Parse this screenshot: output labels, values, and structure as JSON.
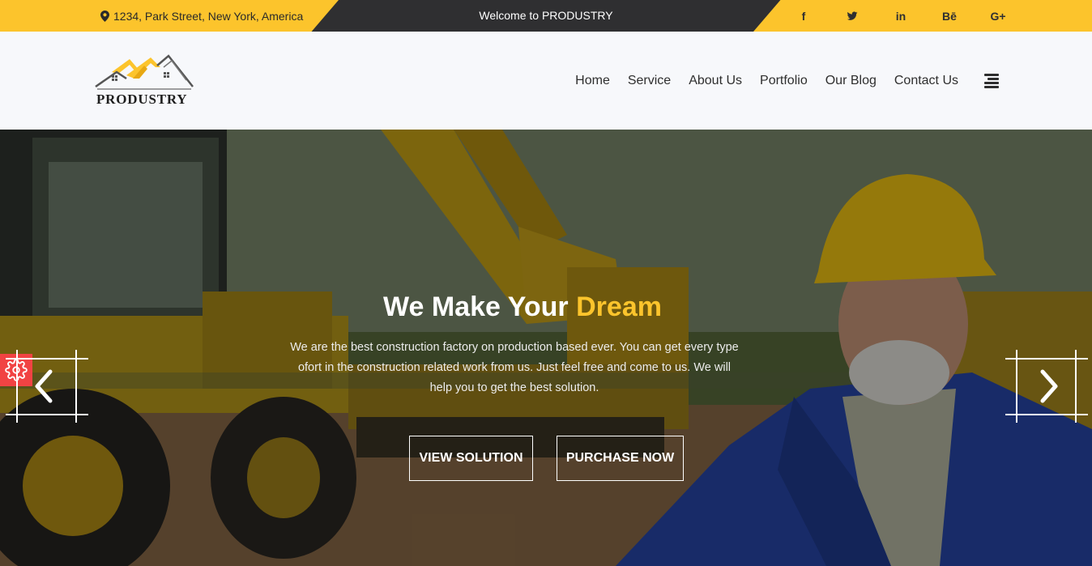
{
  "topbar": {
    "address": "1234, Park Street, New York, America",
    "welcome": "Welcome to PRODUSTRY",
    "social": [
      {
        "name": "facebook-icon",
        "label": "f"
      },
      {
        "name": "twitter-icon",
        "label": ""
      },
      {
        "name": "linkedin-icon",
        "label": "in"
      },
      {
        "name": "behance-icon",
        "label": "Bē"
      },
      {
        "name": "google-plus-icon",
        "label": "G+"
      }
    ]
  },
  "header": {
    "logo_text": "PRODUSTRY",
    "nav": [
      "Home",
      "Service",
      "About Us",
      "Portfolio",
      "Our Blog",
      "Contact Us"
    ]
  },
  "hero": {
    "title_main": "We Make Your",
    "title_accent": "Dream",
    "description": "We are the best construction factory on production based ever. You can get every type ofort in the construction related work from us. Just feel free and come to us. We will help you to get the best solution.",
    "btn_view": "VIEW SOLUTION",
    "btn_purchase": "PURCHASE NOW"
  },
  "colors": {
    "accent": "#fcc42c",
    "dark": "#2f2f31",
    "settings": "#f14343"
  }
}
